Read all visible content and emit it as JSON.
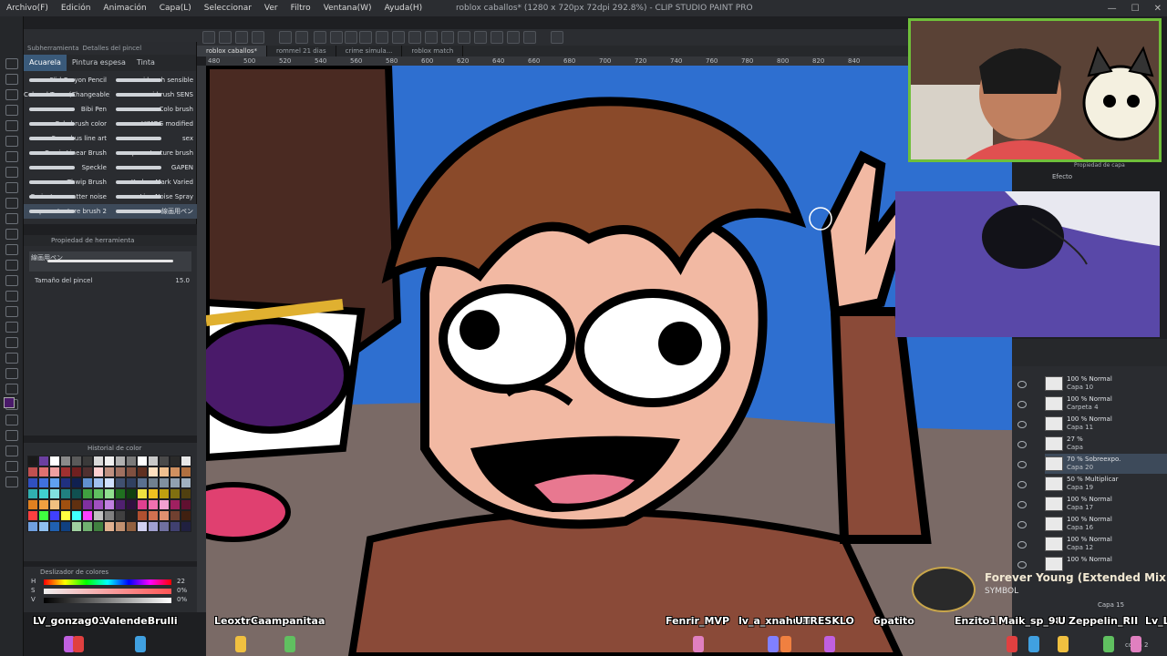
{
  "menu": [
    "Archivo(F)",
    "Edición",
    "Animación",
    "Capa(L)",
    "Seleccionar",
    "Ver",
    "Filtro",
    "Ventana(W)",
    "Ayuda(H)"
  ],
  "window_title": "roblox caballos* (1280 x 720px 72dpi 292.8%) - CLIP STUDIO PAINT PRO",
  "subtool": {
    "tabs": [
      "Subherramienta",
      "Detalles del pincel"
    ],
    "brush_tabs": [
      "Acuarela",
      "Pintura espesa",
      "Tinta"
    ],
    "brushes": [
      "Slid Crayon Pencil",
      "mi brush sensible",
      "Colored Trees (Changeable)",
      "mi brush SENS",
      "Bibi Pen",
      "Colo brush",
      "Colo brush color",
      "HIMOG modified",
      "Succubus line art",
      "sex",
      "Comic Linear Brush",
      "square texture brush",
      "Speckle",
      "GAPEN",
      "Thwip Brush",
      "Kraken Mark Varied",
      "Caricature scatter noise",
      "Line Noise Spray",
      "square texture brush 2",
      "線画用ペン"
    ]
  },
  "tool_property": {
    "header": "Propiedad de herramienta",
    "preview_label": "線画用ペン",
    "size_label": "Tamaño del pincel",
    "size_value": "15.0"
  },
  "color_history": {
    "title": "Historial de color",
    "swatches": [
      "#1a1a1a",
      "#6b3fa0",
      "#ffffff",
      "#8a8a8a",
      "#5a5a5a",
      "#3a3a3a",
      "#d9d9d9",
      "#f0f0f0",
      "#b0b0b0",
      "#7a7a7a",
      "#ffffff",
      "#c8c8c8",
      "#4a4a4a",
      "#2a2a2a",
      "#e8e8e8",
      "#c05050",
      "#e07070",
      "#f0a0a0",
      "#a03030",
      "#702020",
      "#503030",
      "#ffd0d0",
      "#c09080",
      "#a07060",
      "#805040",
      "#603020",
      "#ffe0c0",
      "#f0c090",
      "#d09060",
      "#b07040",
      "#3050c0",
      "#4070e0",
      "#60a0f0",
      "#203080",
      "#102050",
      "#6090d0",
      "#a0c0f0",
      "#d0e0ff",
      "#405070",
      "#304060",
      "#5a7090",
      "#708090",
      "#8090a0",
      "#90a0b0",
      "#a0b0c0",
      "#30b0b0",
      "#40d0d0",
      "#80e0e0",
      "#208080",
      "#105050",
      "#40a040",
      "#60c060",
      "#90e090",
      "#207020",
      "#104010",
      "#f0e040",
      "#f0c020",
      "#c0a010",
      "#807010",
      "#504010",
      "#e08020",
      "#f0a040",
      "#f0c080",
      "#a05010",
      "#603010",
      "#8030a0",
      "#a050c0",
      "#c080e0",
      "#502070",
      "#301040",
      "#e04090",
      "#f070b0",
      "#f0a0d0",
      "#a02060",
      "#601030",
      "#ff4040",
      "#40ff40",
      "#4040ff",
      "#ffff40",
      "#40ffff",
      "#ff40ff",
      "#c0c0c0",
      "#808080",
      "#404040",
      "#202020",
      "#b05030",
      "#d07050",
      "#e09070",
      "#704030",
      "#402010",
      "#70a0e0",
      "#90c0f0",
      "#2060b0",
      "#104080",
      "#a0d0a0",
      "#70b070",
      "#408040",
      "#e0b090",
      "#c09070",
      "#906040",
      "#d0d0f0",
      "#a0a0d0",
      "#7070a0",
      "#404070",
      "#202040"
    ]
  },
  "color_slider": {
    "title": "Deslizador de colores",
    "rows": [
      {
        "label": "H",
        "value": "22"
      },
      {
        "label": "S",
        "value": "0%"
      },
      {
        "label": "V",
        "value": "0%"
      }
    ]
  },
  "doc_tabs": [
    "roblox caballos*",
    "rommel 21 dias",
    "crime simula...",
    "roblox match"
  ],
  "ruler": [
    "480",
    "500",
    "520",
    "540",
    "560",
    "580",
    "600",
    "620",
    "640",
    "660",
    "680",
    "700",
    "720",
    "740",
    "760",
    "780",
    "800",
    "820",
    "840"
  ],
  "layers": [
    {
      "mode": "100 % Normal",
      "name": "Capa 10"
    },
    {
      "mode": "100 % Normal",
      "name": "Carpeta 4"
    },
    {
      "mode": "100 % Normal",
      "name": "Capa 11"
    },
    {
      "mode": "27 %",
      "name": "Capa"
    },
    {
      "mode": "70 % Sobreexpo.",
      "name": "Capa 20"
    },
    {
      "mode": "50 % Multiplicar",
      "name": "Capa 19"
    },
    {
      "mode": "100 % Normal",
      "name": "Capa 17"
    },
    {
      "mode": "100 % Normal",
      "name": "Capa 16"
    },
    {
      "mode": "100 % Normal",
      "name": "Capa 12"
    },
    {
      "mode": "100 % Normal",
      "name": ""
    }
  ],
  "layer_extra": {
    "efecto": "Efecto",
    "propiedad": "Propiedad de capa",
    "capa15": "Capa 15",
    "copia2": "copia 2"
  },
  "now_playing": {
    "title": "Forever Young (Extended Mix)",
    "artist": "SYMBOL"
  },
  "viewers": [
    "LV_gonzag03",
    "ValendeBrulli",
    "Leoxtre",
    "Caampanitaa",
    "Fenrir_MVP",
    "lv_a_xnahuel",
    "UTRESKLO",
    "6patito",
    "Enzito1",
    "Maik_sp_98",
    "U",
    "Zeppelin_RII",
    "Lv_L"
  ],
  "colors": {
    "accent": "#3a5a7a",
    "sky": "#2e6fd0",
    "webcam_border": "#6fbf3a"
  }
}
